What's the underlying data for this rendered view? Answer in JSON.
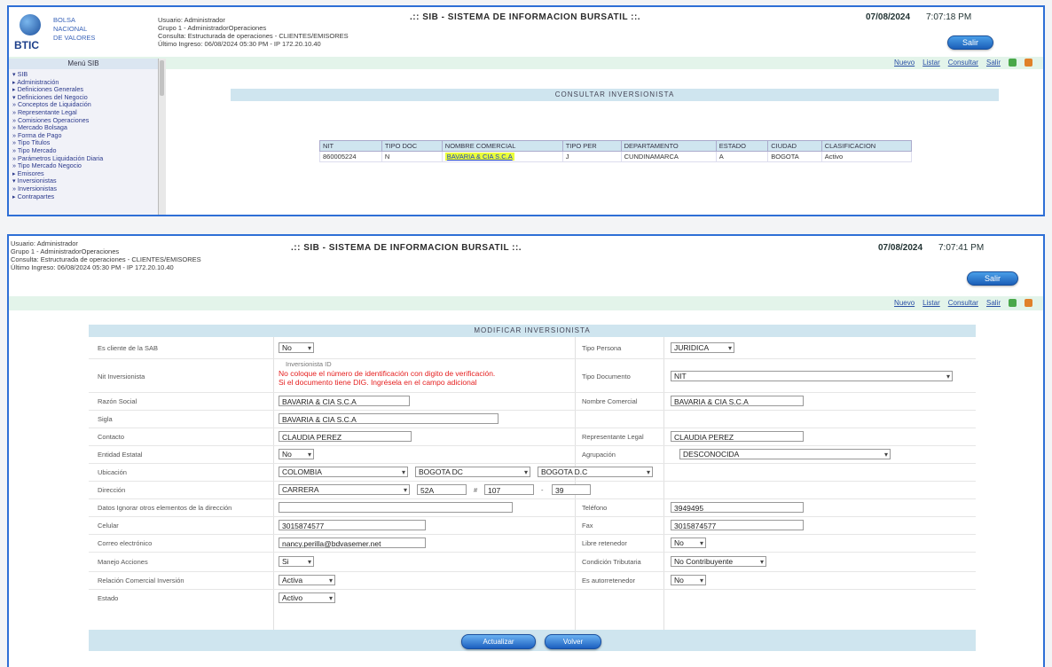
{
  "top": {
    "system_name": ".:: SIB - SISTEMA DE INFORMACION BURSATIL ::.",
    "date": "07/08/2024",
    "time": "7:07:18 PM",
    "exit_button": "Salir",
    "logo": {
      "text": "BTIC",
      "sub": [
        "BOLSA",
        "NACIONAL",
        "DE VALORES"
      ]
    },
    "user_info": [
      "Usuario: Administrador",
      "Grupo 1 - AdministradorOperaciones",
      "Consulta: Estructurada de operaciones - CLIENTES/EMISORES",
      "Último Ingreso: 06/08/2024 05:30 PM - IP 172.20.10.40"
    ],
    "nav_links": [
      "Nuevo",
      "Listar",
      "Consultar",
      "Salir"
    ],
    "sidebar_title": "Menú SIB",
    "tree": [
      "▾ SIB",
      "  ▸ Administración",
      "  ▸ Definiciones Generales",
      "  ▾ Definiciones del Negocio",
      "     » Conceptos de Liquidación",
      "     » Representante Legal",
      "     » Comisiones Operaciones",
      "     » Mercado Bolsaga",
      "     » Forma de Pago",
      "     » Tipo Titulos",
      "     » Tipo Mercado",
      "     » Parámetros Liquidación Diaria",
      "     » Tipo Mercado Negocio",
      "  ▸ Emisores",
      "  ▾ Inversionistas",
      "     » Inversionistas",
      "  ▸ Contrapartes"
    ],
    "consulta_title": "CONSULTAR INVERSIONISTA",
    "table": {
      "headers": [
        "NIT",
        "TIPO DOC",
        "NOMBRE COMERCIAL",
        "TIPO PER",
        "DEPARTAMENTO",
        "ESTADO",
        "CIUDAD",
        "CLASIFICACION"
      ],
      "row": [
        "860005224",
        "N",
        "BAVARIA & CIA S.C.A",
        "J",
        "CUNDINAMARCA",
        "A",
        "BOGOTA",
        "Activo"
      ]
    }
  },
  "bottom": {
    "system_name": ".:: SIB - SISTEMA DE INFORMACION BURSATIL ::.",
    "date": "07/08/2024",
    "time": "7:07:41 PM",
    "exit_button": "Salir",
    "user_info": [
      "Usuario: Administrador",
      "Grupo 1 - AdministradorOperaciones",
      "Consulta: Estructurada de operaciones - CLIENTES/EMISORES",
      "Último Ingreso: 06/08/2024 05:30 PM - IP 172.20.10.40"
    ],
    "nav_links": [
      "Nuevo",
      "Listar",
      "Consultar",
      "Salir"
    ],
    "modify_title": "MODIFICAR INVERSIONISTA",
    "form": {
      "cliente_label": "Es cliente de la SAB",
      "cliente_value": "No",
      "tipo_persona_label": "Tipo Persona",
      "tipo_persona_value": "JURIDICA",
      "id_label": "Nit Inversionista",
      "id_hint": "Inversionista ID",
      "warn1": "No coloque el número de identificación con digito de verificación.",
      "warn2": "Si el documento tiene DIG. Ingrésela en el campo adicional",
      "tipo_doc_label": "Tipo Documento",
      "tipo_doc_value": "NIT",
      "razon_label": "Razón Social",
      "razon_value": "BAVARIA & CIA S.C.A",
      "nombre_com_label": "Nombre Comercial",
      "nombre_com_value": "BAVARIA & CIA S.C.A",
      "sigla_label": "Sigla",
      "sigla_value": "BAVARIA & CIA S.C.A",
      "contacto_label": "Contacto",
      "contacto_value": "CLAUDIA PEREZ",
      "rep_label": "Representante Legal",
      "rep_value": "CLAUDIA PEREZ",
      "entidad_label": "Entidad Estatal",
      "entidad_value": "No",
      "agrupacion_label": "Agrupación",
      "agrupacion_value": "DESCONOCIDA",
      "ubicacion_label": "Ubicación",
      "pais_value": "COLOMBIA",
      "depto_value": "BOGOTA DC",
      "ciudad_value": "BOGOTA D.C",
      "direccion_label": "Dirección",
      "dir_tipo": "CARRERA",
      "dir_num": "52A",
      "dir_sep1": "#",
      "dir_num2": "107",
      "dir_sep2": "-",
      "dir_num3": "39",
      "datos_label": "Datos Ignorar otros elementos de la dirección",
      "datos_value": "",
      "telefono_label": "Teléfono",
      "telefono_value": "3949495",
      "celular_label": "Celular",
      "celular_value": "3015874577",
      "fax_label": "Fax",
      "fax_value": "3015874577",
      "correo_label": "Correo electrónico",
      "correo_value": "nancy.perilla@bdvasemer.net",
      "libre_label": "Libre retenedor",
      "libre_value": "No",
      "riesgo_label": "Manejo Acciones",
      "riesgo_value": "Si",
      "condicion_label": "Condición Tributaria",
      "condicion_value": "No Contribuyente",
      "relacion_label": "Relación Comercial Inversión",
      "relacion_value": "Activa",
      "autoret_label": "Es autorretenedor",
      "autoret_value": "No",
      "estado_label": "Estado",
      "estado_value": "Activo"
    },
    "buttons": {
      "save": "Actualizar",
      "cancel": "Volver"
    }
  },
  "colors": {
    "frame": "#2e6fd6",
    "panel_bar": "#cfe5ef",
    "nav_bar": "#e3f4ea",
    "warning": "#e52020",
    "link": "#2a4fa5"
  }
}
